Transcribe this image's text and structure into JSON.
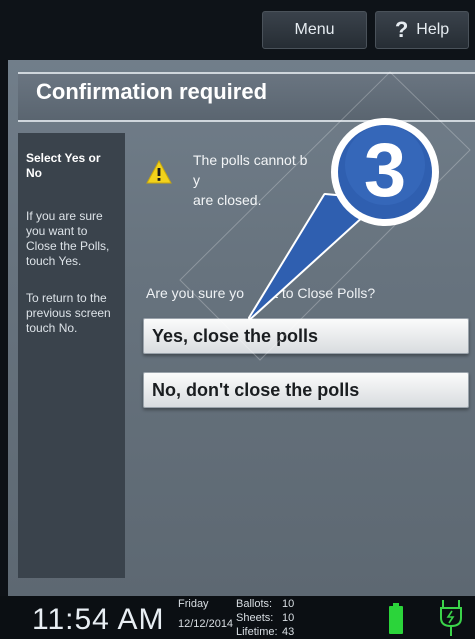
{
  "header": {
    "menu_label": "Menu",
    "help_icon": "?",
    "help_label": "Help"
  },
  "dialog": {
    "title": "Confirmation required",
    "message": "The polls cannot b",
    "message_end": "y",
    "message_line2": "are closed.",
    "question_start": "Are you sure yo",
    "question_end": "t to Close Polls?"
  },
  "sidebar": {
    "heading": "Select Yes or No",
    "para1": "If you are sure you want to Close the Polls, touch Yes.",
    "para2": "To return to the previous screen touch No."
  },
  "buttons": {
    "yes_label": "Yes, close the polls",
    "no_label": "No, don't close the polls"
  },
  "callout": {
    "step_number": "3",
    "color": "#2f5fb0"
  },
  "status": {
    "time": "11:54 AM",
    "day": "Friday",
    "date": "12/12/2014",
    "ballots_label": "Ballots:",
    "ballots_value": "10",
    "sheets_label": "Sheets:",
    "sheets_value": "10",
    "lifetime_label": "Lifetime:",
    "lifetime_value": "43"
  },
  "colors": {
    "battery": "#2bd43a",
    "plug": "#3bd44a"
  }
}
